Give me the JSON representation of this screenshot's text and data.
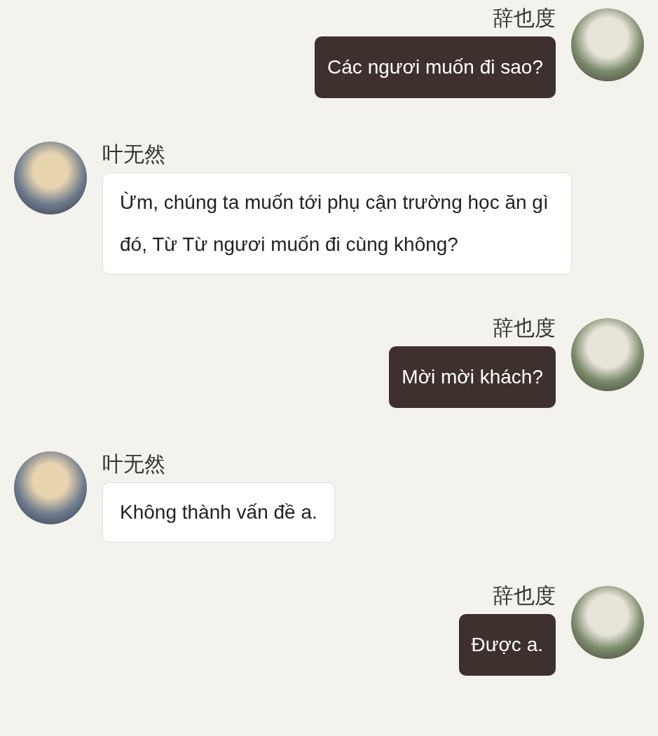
{
  "messages": [
    {
      "kind": "outgoing",
      "sender": "辞也度",
      "text": "Các ngươi muốn đi sao?"
    },
    {
      "kind": "incoming",
      "sender": "叶无然",
      "text": "Ừm, chúng ta muốn tới phụ cận trường học ăn gì đó, Từ Từ ngươi muốn đi cùng không?"
    },
    {
      "kind": "outgoing",
      "sender": "辞也度",
      "text": "Mời mời khách?"
    },
    {
      "kind": "incoming",
      "sender": "叶无然",
      "text": "Không thành vấn đề a."
    },
    {
      "kind": "outgoing",
      "sender": "辞也度",
      "text": "Được a."
    }
  ]
}
